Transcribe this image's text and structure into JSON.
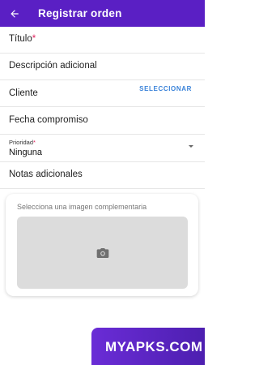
{
  "appbar": {
    "title": "Registrar orden"
  },
  "form": {
    "title_label": "Título",
    "title_required": "*",
    "description_label": "Descripción adicional",
    "client_label": "Cliente",
    "client_action": "SELECCIONAR",
    "date_label": "Fecha compromiso",
    "priority": {
      "label": "Prioridad",
      "required": "*",
      "value": "Ninguna"
    },
    "notes_label": "Notas adicionales"
  },
  "image_card": {
    "prompt": "Selecciona una imagen complementaria"
  },
  "watermark": {
    "text": "MYAPKS.COM"
  },
  "colors": {
    "appbar": "#5a1fc4",
    "link": "#3b83d9",
    "required": "#e0245e"
  },
  "icons": {
    "back": "arrow-left-icon",
    "camera": "camera-icon",
    "dropdown": "chevron-down-icon"
  }
}
